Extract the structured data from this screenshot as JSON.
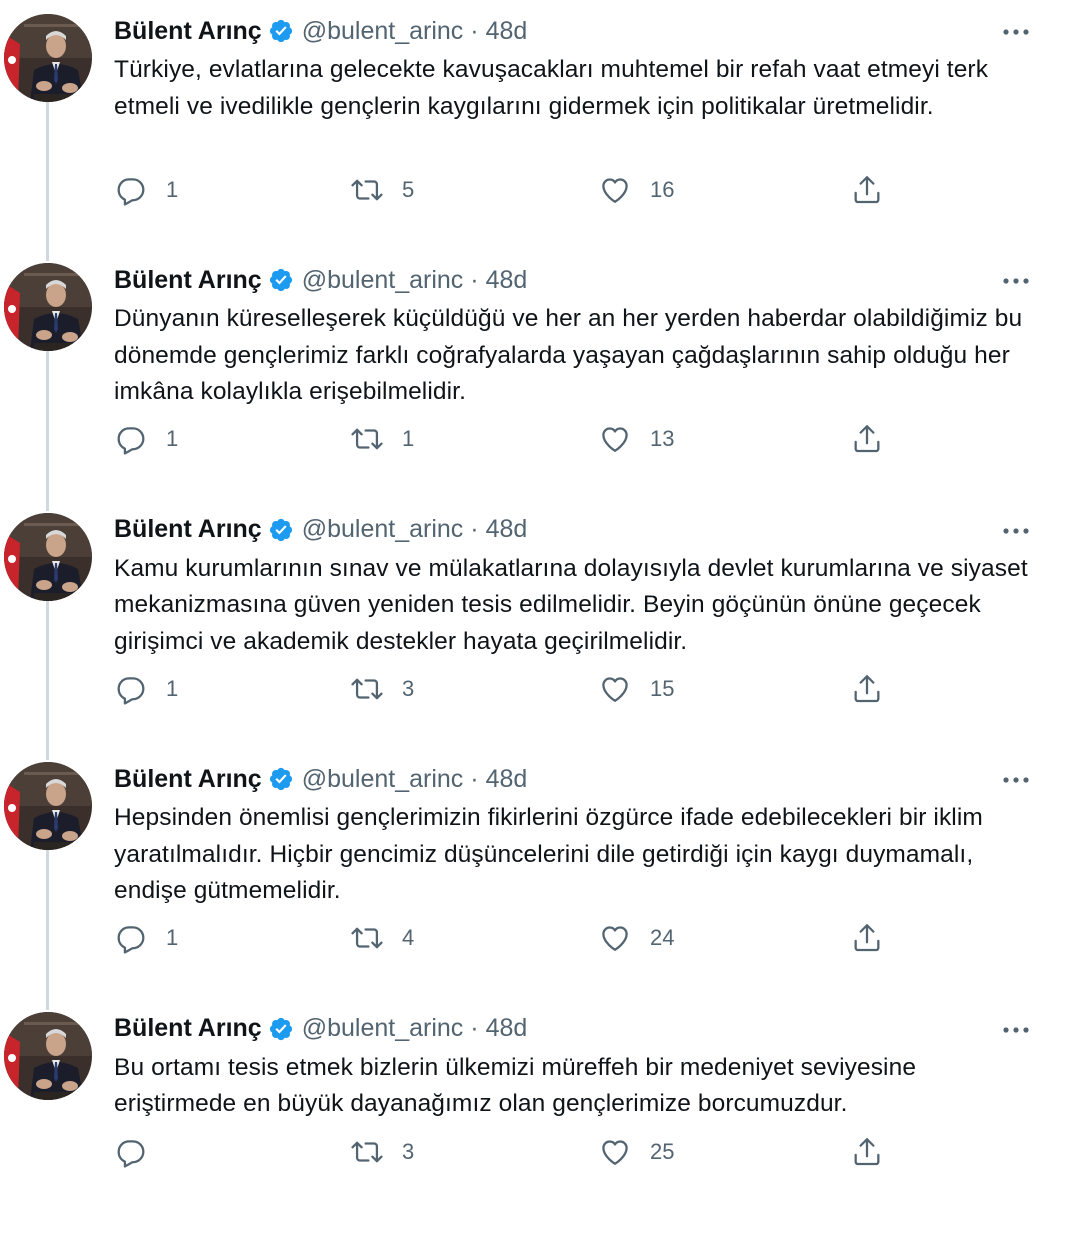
{
  "author": {
    "name": "Bülent Arınç",
    "handle": "@bulent_arinc",
    "separator": "·",
    "time": "48d"
  },
  "icons": {
    "verified": "verified-badge-icon",
    "more": "more-options-icon",
    "reply": "reply-icon",
    "retweet": "retweet-icon",
    "like": "like-icon",
    "share": "share-icon"
  },
  "colors": {
    "verified": "#1d9bf0",
    "secondary_text": "#536471",
    "thread_line": "#cfd9de"
  },
  "tweets": [
    {
      "text": "Türkiye, evlatlarına gelecekte kavuşacakları muhtemel bir refah vaat etmeyi terk etmeli ve ivedilikle gençlerin kaygılarını gidermek için politikalar üretmelidir.",
      "replies": "1",
      "retweets": "5",
      "likes": "16"
    },
    {
      "text": "Dünyanın küreselleşerek küçüldüğü ve her an her yerden haberdar olabildiğimiz bu dönemde gençlerimiz farklı coğrafyalarda yaşayan çağdaşlarının sahip olduğu her imkâna kolaylıkla erişebilmelidir.",
      "replies": "1",
      "retweets": "1",
      "likes": "13"
    },
    {
      "text": "Kamu kurumlarının sınav ve mülakatlarına dolayısıyla devlet kurumlarına ve siyaset mekanizmasına güven yeniden tesis edilmelidir. Beyin göçünün önüne geçecek girişimci ve akademik destekler hayata geçirilmelidir.",
      "replies": "1",
      "retweets": "3",
      "likes": "15"
    },
    {
      "text": "Hepsinden önemlisi gençlerimizin fikirlerini özgürce ifade edebilecekleri bir iklim yaratılmalıdır. Hiçbir gencimiz düşüncelerini dile getirdiği için kaygı duymamalı, endişe gütmemelidir.",
      "replies": "1",
      "retweets": "4",
      "likes": "24"
    },
    {
      "text": "Bu ortamı tesis etmek bizlerin ülkemizi müreffeh bir medeniyet seviyesine eriştirmede en büyük dayanağımız olan gençlerimize borcumuzdur.",
      "replies": "",
      "retweets": "3",
      "likes": "25"
    }
  ]
}
